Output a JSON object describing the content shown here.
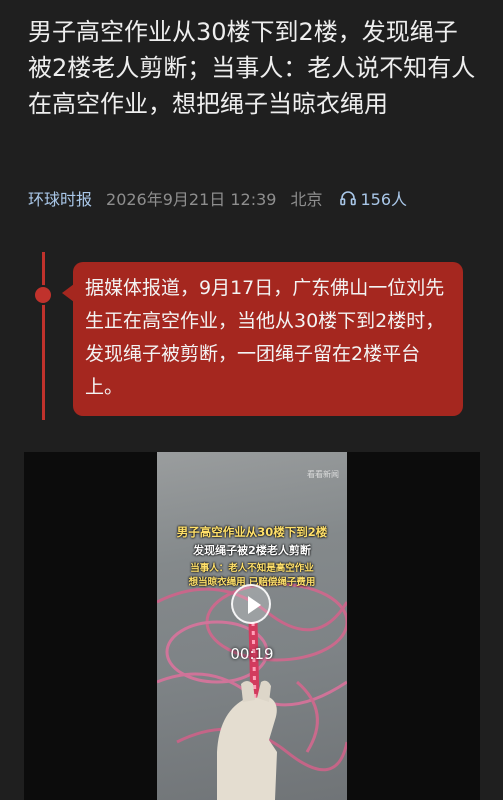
{
  "article": {
    "title": "男子高空作业从30楼下到2楼，发现绳子被2楼老人剪断；当事人：老人说不知有人在高空作业，想把绳子当晾衣绳用",
    "source": "环球时报",
    "datetime": "2026年9月21日 12:39",
    "location": "北京",
    "listeners": "156人"
  },
  "summary": {
    "text": "据媒体报道，9月17日，广东佛山一位刘先生正在高空作业，当他从30楼下到2楼时，发现绳子被剪断，一团绳子留在2楼平台上。"
  },
  "video": {
    "caption_line1": "男子高空作业从30楼下到2楼",
    "caption_line2": "发现绳子被2楼老人剪断",
    "caption_line3": "当事人：老人不知是高空作业",
    "caption_line4": "想当晾衣绳用 已赔偿绳子费用",
    "watermark": "看看新闻",
    "duration": "00:19"
  },
  "colors": {
    "background": "#1f1f1f",
    "accent_red": "#a5271f",
    "link_blue": "#a9c7e8"
  }
}
